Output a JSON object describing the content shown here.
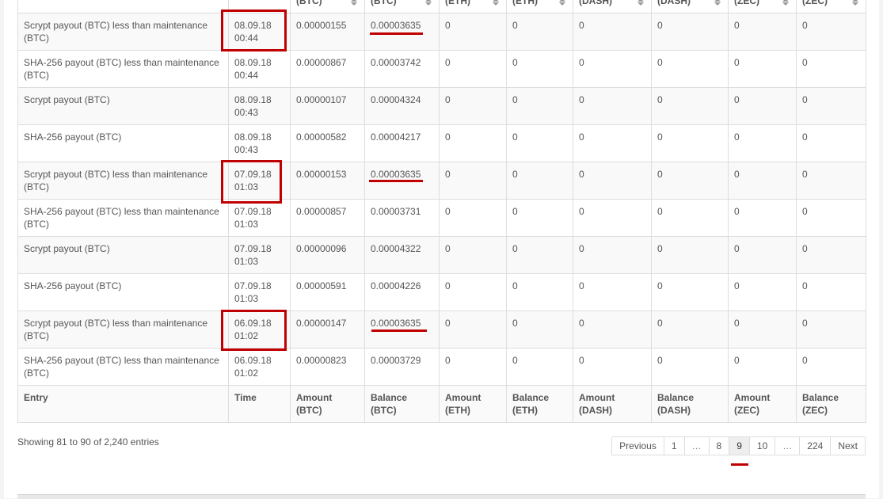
{
  "table": {
    "header_top": [
      "",
      "",
      "(BTC)",
      "(BTC)",
      "(ETH)",
      "(ETH)",
      "(DASH)",
      "(DASH)",
      "(ZEC)",
      "(ZEC)"
    ],
    "footer": [
      [
        "Entry",
        ""
      ],
      [
        "Time",
        ""
      ],
      [
        "Amount",
        "(BTC)"
      ],
      [
        "Balance",
        "(BTC)"
      ],
      [
        "Amount",
        "(ETH)"
      ],
      [
        "Balance",
        "(ETH)"
      ],
      [
        "Amount",
        "(DASH)"
      ],
      [
        "Balance",
        "(DASH)"
      ],
      [
        "Amount",
        "(ZEC)"
      ],
      [
        "Balance",
        "(ZEC)"
      ]
    ],
    "rows": [
      {
        "entry": "Scrypt payout (BTC) less than maintenance (BTC)",
        "date": "08.09.18",
        "time": "00:44",
        "amount_btc": "0.00000155",
        "balance_btc": "0.00003635",
        "eth_a": "0",
        "eth_b": "0",
        "dash_a": "0",
        "dash_b": "0",
        "zec_a": "0",
        "zec_b": "0",
        "amount_highlight": true
      },
      {
        "entry": "SHA-256 payout (BTC) less than maintenance (BTC)",
        "date": "08.09.18",
        "time": "00:44",
        "amount_btc": "0.00000867",
        "balance_btc": "0.00003742",
        "eth_a": "0",
        "eth_b": "0",
        "dash_a": "0",
        "dash_b": "0",
        "zec_a": "0",
        "zec_b": "0",
        "amount_highlight": true
      },
      {
        "entry": "Scrypt payout (BTC)",
        "date": "08.09.18",
        "time": "00:43",
        "amount_btc": "0.00000107",
        "balance_btc": "0.00004324",
        "eth_a": "0",
        "eth_b": "0",
        "dash_a": "0",
        "dash_b": "0",
        "zec_a": "0",
        "zec_b": "0",
        "amount_highlight": false
      },
      {
        "entry": "SHA-256 payout (BTC)",
        "date": "08.09.18",
        "time": "00:43",
        "amount_btc": "0.00000582",
        "balance_btc": "0.00004217",
        "eth_a": "0",
        "eth_b": "0",
        "dash_a": "0",
        "dash_b": "0",
        "zec_a": "0",
        "zec_b": "0",
        "amount_highlight": false
      },
      {
        "entry": "Scrypt payout (BTC) less than maintenance (BTC)",
        "date": "07.09.18",
        "time": "01:03",
        "amount_btc": "0.00000153",
        "balance_btc": "0.00003635",
        "eth_a": "0",
        "eth_b": "0",
        "dash_a": "0",
        "dash_b": "0",
        "zec_a": "0",
        "zec_b": "0",
        "amount_highlight": true
      },
      {
        "entry": "SHA-256 payout (BTC) less than maintenance (BTC)",
        "date": "07.09.18",
        "time": "01:03",
        "amount_btc": "0.00000857",
        "balance_btc": "0.00003731",
        "eth_a": "0",
        "eth_b": "0",
        "dash_a": "0",
        "dash_b": "0",
        "zec_a": "0",
        "zec_b": "0",
        "amount_highlight": true
      },
      {
        "entry": "Scrypt payout (BTC)",
        "date": "07.09.18",
        "time": "01:03",
        "amount_btc": "0.00000096",
        "balance_btc": "0.00004322",
        "eth_a": "0",
        "eth_b": "0",
        "dash_a": "0",
        "dash_b": "0",
        "zec_a": "0",
        "zec_b": "0",
        "amount_highlight": false
      },
      {
        "entry": "SHA-256 payout (BTC)",
        "date": "07.09.18",
        "time": "01:03",
        "amount_btc": "0.00000591",
        "balance_btc": "0.00004226",
        "eth_a": "0",
        "eth_b": "0",
        "dash_a": "0",
        "dash_b": "0",
        "zec_a": "0",
        "zec_b": "0",
        "amount_highlight": false
      },
      {
        "entry": "Scrypt payout (BTC) less than maintenance (BTC)",
        "date": "06.09.18",
        "time": "01:02",
        "amount_btc": "0.00000147",
        "balance_btc": "0.00003635",
        "eth_a": "0",
        "eth_b": "0",
        "dash_a": "0",
        "dash_b": "0",
        "zec_a": "0",
        "zec_b": "0",
        "amount_highlight": true
      },
      {
        "entry": "SHA-256 payout (BTC) less than maintenance (BTC)",
        "date": "06.09.18",
        "time": "01:02",
        "amount_btc": "0.00000823",
        "balance_btc": "0.00003729",
        "eth_a": "0",
        "eth_b": "0",
        "dash_a": "0",
        "dash_b": "0",
        "zec_a": "0",
        "zec_b": "0",
        "amount_highlight": true
      }
    ]
  },
  "info_text": "Showing 81 to 90 of 2,240 entries",
  "pagination": {
    "previous": "Previous",
    "pages": [
      "1",
      "…",
      "8",
      "9",
      "10",
      "…",
      "224"
    ],
    "active": "9",
    "next": "Next"
  },
  "colors": {
    "highlight_amount": "#e0507a",
    "annotation_red": "#c00000"
  },
  "icons": [
    "sort-arrows-icon"
  ]
}
